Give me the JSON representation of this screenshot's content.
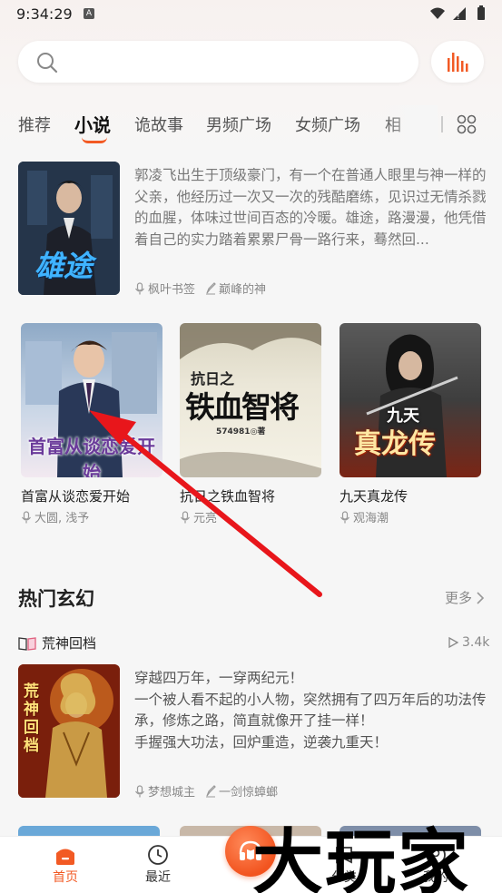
{
  "status_bar": {
    "time": "9:34:29",
    "a_badge": "A"
  },
  "search": {
    "placeholder": "",
    "value": ""
  },
  "tabs": [
    {
      "label": "推荐"
    },
    {
      "label": "小说"
    },
    {
      "label": "诡故事"
    },
    {
      "label": "男频广场"
    },
    {
      "label": "女频广场"
    },
    {
      "label": "相"
    }
  ],
  "featured": {
    "cover_title": "雄途",
    "description": "郭凌飞出生于顶级豪门，有一个在普通人眼里与神一样的父亲，他经历过一次又一次的残酷磨练，见识过无情杀戮的血腥，体味过世间百态的冷暖。雄途，路漫漫，他凭借着自己的实力踏着累累尸骨一路行来，蓦然回...",
    "narrator": "枫叶书签",
    "author": "巅峰的神"
  },
  "books": [
    {
      "title": "首富从谈恋爱开始",
      "author": "大圆, 浅予",
      "cover_text": "首富从谈恋爱开始"
    },
    {
      "title": "抗日之铁血智将",
      "author": "元亮",
      "cover_text_top": "抗日之",
      "cover_text_main": "铁血智将",
      "cover_author": "574981◎著"
    },
    {
      "title": "九天真龙传",
      "author": "观海潮",
      "cover_text_top": "九天",
      "cover_text_main": "真龙传"
    }
  ],
  "section": {
    "title": "热门玄幻",
    "more": "更多",
    "book": {
      "title": "荒神回档",
      "plays": "3.4k",
      "description": "穿越四万年，一穿两纪元！\n一个被人看不起的小人物，突然拥有了四万年后的功法传承，修炼之路，简直就像开了挂一样！\n手握强大功法，回炉重造，逆袭九重天！",
      "narrator": "梦想城主",
      "author": "一剑惊蟑螂",
      "cover_text": "荒神回档"
    }
  },
  "bottom_nav": [
    {
      "label": "首页"
    },
    {
      "label": "最近"
    },
    {
      "label": "分类"
    },
    {
      "label": "我的"
    }
  ],
  "watermark": "大玩家",
  "colors": {
    "accent": "#f25a24",
    "annotation_arrow": "#e8161b"
  }
}
